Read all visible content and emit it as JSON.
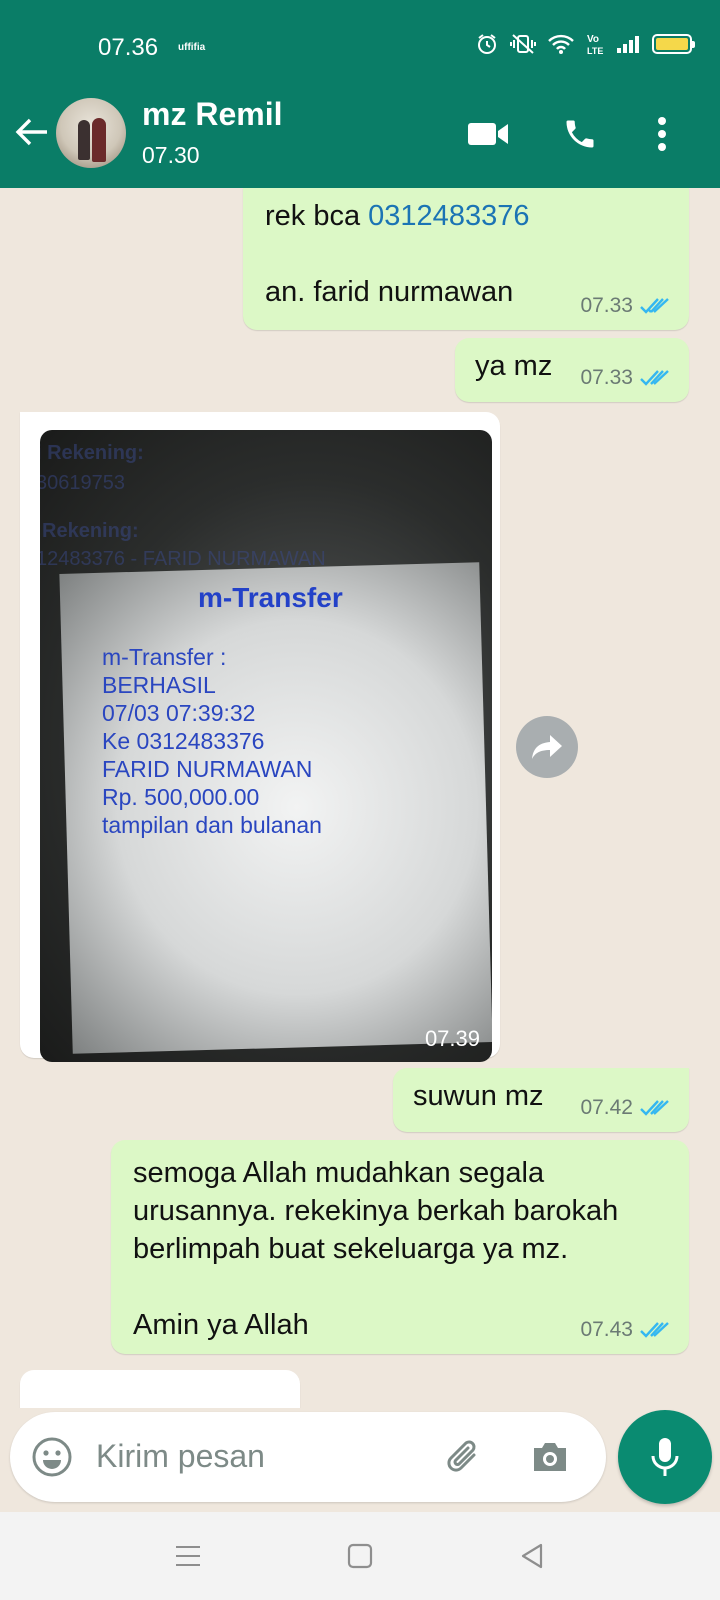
{
  "status_bar": {
    "time": "07.36",
    "carrier": "uffifia",
    "icons": [
      "alarm-icon",
      "vibrate-mute-icon",
      "wifi-icon",
      "volte-icon",
      "signal-icon",
      "battery-icon"
    ],
    "battery_color": "#f5d84a"
  },
  "header": {
    "contact_name": "mz Remil",
    "last_seen": "07.30",
    "icons": [
      "back-arrow-icon",
      "video-call-icon",
      "voice-call-icon",
      "more-vert-icon"
    ],
    "color": "#0a7d67"
  },
  "messages": [
    {
      "direction": "outgoing",
      "text_prefix": "rek bca ",
      "link": "0312483376",
      "line2": "an. farid nurmawan",
      "time": "07.33",
      "status": "read"
    },
    {
      "direction": "outgoing",
      "text": "ya mz",
      "time": "07.33",
      "status": "read"
    },
    {
      "direction": "incoming",
      "type": "image",
      "image": {
        "bg_line1": "i Rekening:",
        "bg_line2": "30619753",
        "bg_line3": "Rekening:",
        "bg_line4": "12483376 - FARID NURMAWAN",
        "title": "m-Transfer",
        "lines": [
          "m-Transfer :",
          "BERHASIL",
          "07/03 07:39:32",
          "Ke 0312483376",
          "FARID NURMAWAN",
          "Rp. 500,000.00",
          "tampilan dan bulanan"
        ]
      },
      "time": "07.39"
    },
    {
      "direction": "outgoing",
      "text": "suwun mz",
      "time": "07.42",
      "status": "read"
    },
    {
      "direction": "outgoing",
      "lines": [
        "semoga Allah mudahkan segala",
        "urusannya. rekekinya berkah barokah",
        "berlimpah buat sekeluarga ya mz."
      ],
      "line_after": "Amin ya Allah",
      "time": "07.43",
      "status": "read"
    }
  ],
  "composer": {
    "placeholder": "Kirim pesan",
    "icons": [
      "emoji-icon",
      "attach-icon",
      "camera-icon",
      "mic-icon"
    ],
    "mic_color": "#0a8b71"
  },
  "nav_bar": {
    "icons": [
      "recents-icon",
      "home-icon",
      "back-icon"
    ]
  }
}
